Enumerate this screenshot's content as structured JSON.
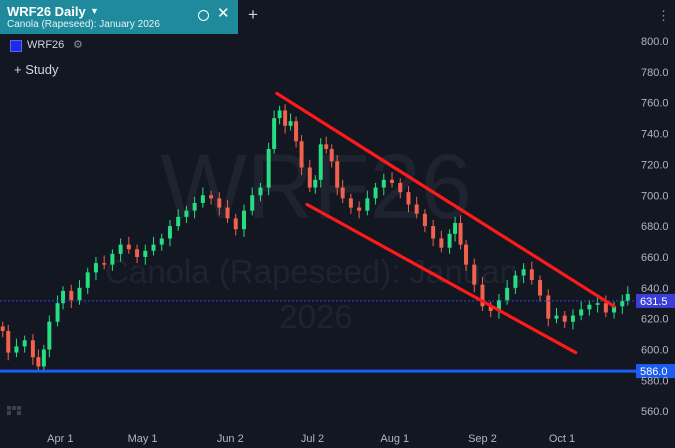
{
  "header": {
    "title": "WRF26 Daily",
    "caret_icon": "caret-down-icon",
    "subtitle": "Canola (Rapeseed): January 2026",
    "window_circle_icon": "circle-icon",
    "close_icon": "close-icon",
    "new_tab_icon": "plus-icon",
    "menu_icon": "kebab-menu-icon"
  },
  "legend": {
    "symbol": "WRF26",
    "color": "#1f29e6",
    "settings_icon": "gear-icon"
  },
  "study_button": {
    "label": "+ Study"
  },
  "watermark": {
    "symbol": "WRF26",
    "name": "Canola (Rapeseed): January",
    "year": "2026"
  },
  "colors": {
    "background": "#131722",
    "up": "#26de81",
    "down": "#f0624d",
    "trendline": "#ff1a1a",
    "horizontal_line": "#1d5cf2",
    "current_price_line": "#3a3fd8"
  },
  "chart_data": {
    "type": "candlestick",
    "title": "WRF26 Daily",
    "subtitle": "Canola (Rapeseed): January 2026",
    "xlabel": "",
    "ylabel": "",
    "ylim": [
      546,
      808
    ],
    "y_ticks": [
      "560.0",
      "580.0",
      "600.0",
      "620.0",
      "640.0",
      "660.0",
      "680.0",
      "700.0",
      "720.0",
      "740.0",
      "760.0",
      "780.0",
      "800.0"
    ],
    "x_range": [
      "2025-03-10",
      "2025-10-28"
    ],
    "x_ticks": [
      {
        "label": "Apr 1",
        "date": "2025-04-01"
      },
      {
        "label": "May 1",
        "date": "2025-05-01"
      },
      {
        "label": "Jun 2",
        "date": "2025-06-02"
      },
      {
        "label": "Jul 2",
        "date": "2025-07-02"
      },
      {
        "label": "Aug 1",
        "date": "2025-08-01"
      },
      {
        "label": "Sep 2",
        "date": "2025-09-02"
      },
      {
        "label": "Oct 1",
        "date": "2025-10-01"
      }
    ],
    "closes": [
      {
        "x": "2025-03-11",
        "y": 612
      },
      {
        "x": "2025-03-13",
        "y": 598
      },
      {
        "x": "2025-03-16",
        "y": 602
      },
      {
        "x": "2025-03-19",
        "y": 606
      },
      {
        "x": "2025-03-22",
        "y": 595
      },
      {
        "x": "2025-03-24",
        "y": 589
      },
      {
        "x": "2025-03-26",
        "y": 600
      },
      {
        "x": "2025-03-28",
        "y": 618
      },
      {
        "x": "2025-03-31",
        "y": 630
      },
      {
        "x": "2025-04-02",
        "y": 638
      },
      {
        "x": "2025-04-05",
        "y": 632
      },
      {
        "x": "2025-04-08",
        "y": 640
      },
      {
        "x": "2025-04-11",
        "y": 650
      },
      {
        "x": "2025-04-14",
        "y": 656
      },
      {
        "x": "2025-04-17",
        "y": 655
      },
      {
        "x": "2025-04-20",
        "y": 662
      },
      {
        "x": "2025-04-23",
        "y": 668
      },
      {
        "x": "2025-04-26",
        "y": 665
      },
      {
        "x": "2025-04-29",
        "y": 660
      },
      {
        "x": "2025-05-02",
        "y": 664
      },
      {
        "x": "2025-05-05",
        "y": 668
      },
      {
        "x": "2025-05-08",
        "y": 672
      },
      {
        "x": "2025-05-11",
        "y": 680
      },
      {
        "x": "2025-05-14",
        "y": 686
      },
      {
        "x": "2025-05-17",
        "y": 690
      },
      {
        "x": "2025-05-20",
        "y": 695
      },
      {
        "x": "2025-05-23",
        "y": 700
      },
      {
        "x": "2025-05-26",
        "y": 698
      },
      {
        "x": "2025-05-29",
        "y": 692
      },
      {
        "x": "2025-06-01",
        "y": 685
      },
      {
        "x": "2025-06-04",
        "y": 678
      },
      {
        "x": "2025-06-07",
        "y": 690
      },
      {
        "x": "2025-06-10",
        "y": 700
      },
      {
        "x": "2025-06-13",
        "y": 705
      },
      {
        "x": "2025-06-16",
        "y": 730
      },
      {
        "x": "2025-06-18",
        "y": 750
      },
      {
        "x": "2025-06-20",
        "y": 755
      },
      {
        "x": "2025-06-22",
        "y": 745
      },
      {
        "x": "2025-06-24",
        "y": 748
      },
      {
        "x": "2025-06-26",
        "y": 735
      },
      {
        "x": "2025-06-28",
        "y": 718
      },
      {
        "x": "2025-07-01",
        "y": 705
      },
      {
        "x": "2025-07-03",
        "y": 710
      },
      {
        "x": "2025-07-05",
        "y": 733
      },
      {
        "x": "2025-07-07",
        "y": 730
      },
      {
        "x": "2025-07-09",
        "y": 722
      },
      {
        "x": "2025-07-11",
        "y": 705
      },
      {
        "x": "2025-07-13",
        "y": 698
      },
      {
        "x": "2025-07-16",
        "y": 692
      },
      {
        "x": "2025-07-19",
        "y": 690
      },
      {
        "x": "2025-07-22",
        "y": 698
      },
      {
        "x": "2025-07-25",
        "y": 705
      },
      {
        "x": "2025-07-28",
        "y": 710
      },
      {
        "x": "2025-07-31",
        "y": 708
      },
      {
        "x": "2025-08-03",
        "y": 702
      },
      {
        "x": "2025-08-06",
        "y": 694
      },
      {
        "x": "2025-08-09",
        "y": 688
      },
      {
        "x": "2025-08-12",
        "y": 680
      },
      {
        "x": "2025-08-15",
        "y": 672
      },
      {
        "x": "2025-08-18",
        "y": 666
      },
      {
        "x": "2025-08-21",
        "y": 675
      },
      {
        "x": "2025-08-23",
        "y": 682
      },
      {
        "x": "2025-08-25",
        "y": 668
      },
      {
        "x": "2025-08-27",
        "y": 655
      },
      {
        "x": "2025-08-30",
        "y": 642
      },
      {
        "x": "2025-09-02",
        "y": 628
      },
      {
        "x": "2025-09-05",
        "y": 625
      },
      {
        "x": "2025-09-08",
        "y": 632
      },
      {
        "x": "2025-09-11",
        "y": 640
      },
      {
        "x": "2025-09-14",
        "y": 648
      },
      {
        "x": "2025-09-17",
        "y": 652
      },
      {
        "x": "2025-09-20",
        "y": 645
      },
      {
        "x": "2025-09-23",
        "y": 635
      },
      {
        "x": "2025-09-26",
        "y": 620
      },
      {
        "x": "2025-09-29",
        "y": 622
      },
      {
        "x": "2025-10-02",
        "y": 618
      },
      {
        "x": "2025-10-05",
        "y": 622
      },
      {
        "x": "2025-10-08",
        "y": 626
      },
      {
        "x": "2025-10-11",
        "y": 629
      },
      {
        "x": "2025-10-14",
        "y": 630
      },
      {
        "x": "2025-10-17",
        "y": 624
      },
      {
        "x": "2025-10-20",
        "y": 628
      },
      {
        "x": "2025-10-23",
        "y": 631.5
      },
      {
        "x": "2025-10-25",
        "y": 636
      }
    ],
    "trendlines": [
      {
        "name": "upper channel line",
        "color": "#ff1a1a",
        "start": {
          "x": "2025-06-19",
          "y": 766
        },
        "end": {
          "x": "2025-10-20",
          "y": 628
        }
      },
      {
        "name": "lower channel line",
        "color": "#ff1a1a",
        "start": {
          "x": "2025-06-30",
          "y": 694
        },
        "end": {
          "x": "2025-10-06",
          "y": 598
        }
      }
    ],
    "horizontal_lines": [
      {
        "value": 586.0,
        "label": "586.0",
        "color": "#1d5cf2"
      },
      {
        "value": 631.5,
        "label": "631.5",
        "color": "#3a3fd8",
        "style": "dotted"
      }
    ],
    "last_price": 631.5,
    "grid": false,
    "legend": "top-left"
  }
}
